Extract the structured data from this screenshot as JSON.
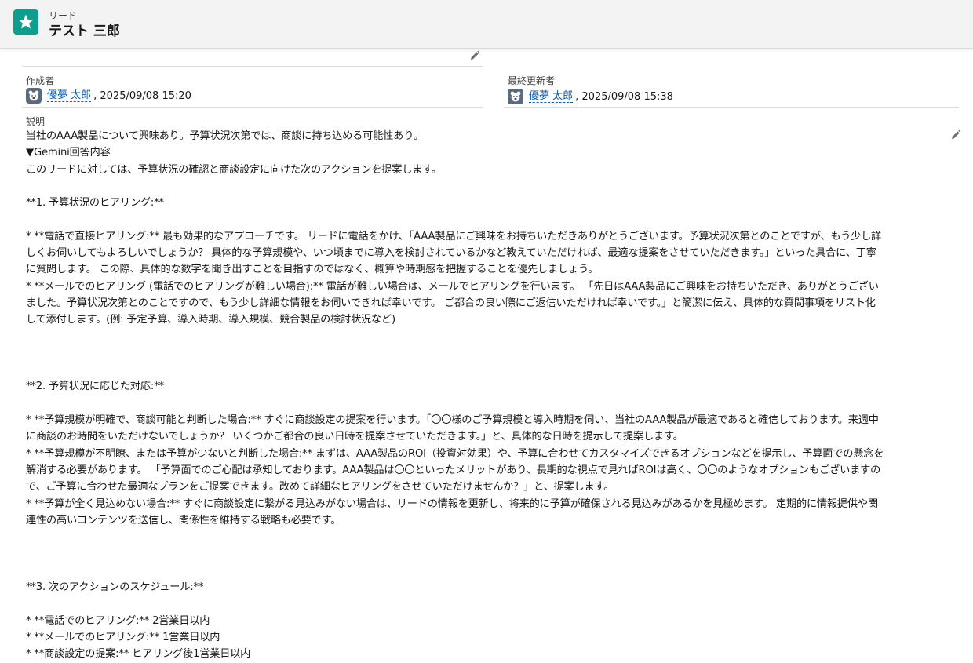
{
  "header": {
    "object_type": "リード",
    "record_name": "テスト 三郎",
    "icon": "lead-star-icon",
    "icon_color": "#0d9e8e"
  },
  "created_by": {
    "label": "作成者",
    "user": "優夢 太郎",
    "date": ", 2025/09/08 15:20"
  },
  "last_modified_by": {
    "label": "最終更新者",
    "user": "優夢 太郎",
    "date": ", 2025/09/08 15:38"
  },
  "description": {
    "label": "説明",
    "lines": [
      "当社のAAA製品について興味あり。予算状況次第では、商談に持ち込める可能性あり。",
      "▼Gemini回答内容",
      "このリードに対しては、予算状況の確認と商談設定に向けた次のアクションを提案します。",
      "",
      "**1. 予算状況のヒアリング:**",
      "",
      "* **電話で直接ヒアリング:** 最も効果的なアプローチです。 リードに電話をかけ、「AAA製品にご興味をお持ちいただきありがとうございます。予算状況次第とのことですが、もう少し詳",
      "しくお伺いしてもよろしいでしょうか？ 具体的な予算規模や、いつ頃までに導入を検討されているかなど教えていただければ、最適な提案をさせていただきます。」といった具合に、丁寧",
      "に質問します。 この際、具体的な数字を聞き出すことを目指すのではなく、概算や時期感を把握することを優先しましょう。",
      "* **メールでのヒアリング (電話でのヒアリングが難しい場合):** 電話が難しい場合は、メールでヒアリングを行います。 「先日はAAA製品にご興味をお持ちいただき、ありがとうござい",
      "ました。予算状況次第とのことですので、もう少し詳細な情報をお伺いできれば幸いです。 ご都合の良い際にご返信いただければ幸いです。」と簡潔に伝え、具体的な質問事項をリスト化",
      "して添付します。(例: 予定予算、導入時期、導入規模、競合製品の検討状況など)",
      "",
      "",
      "",
      "**2. 予算状況に応じた対応:**",
      "",
      "* **予算規模が明確で、商談可能と判断した場合:** すぐに商談設定の提案を行います。「〇〇様のご予算規模と導入時期を伺い、当社のAAA製品が最適であると確信しております。来週中",
      "に商談のお時間をいただけないでしょうか？ いくつかご都合の良い日時を提案させていただきます。」と、具体的な日時を提示して提案します。",
      "* **予算規模が不明瞭、または予算が少ないと判断した場合:** まずは、AAA製品のROI（投資対効果）や、予算に合わせてカスタマイズできるオプションなどを提示し、予算面での懸念を",
      "解消する必要があります。 「予算面でのご心配は承知しております。AAA製品は〇〇といったメリットがあり、長期的な視点で見ればROIは高く、〇〇のようなオプションもございますの",
      "で、ご予算に合わせた最適なプランをご提案できます。改めて詳細なヒアリングをさせていただけませんか？」と、提案します。",
      "* **予算が全く見込めない場合:** すぐに商談設定に繋がる見込みがない場合は、リードの情報を更新し、将来的に予算が確保される見込みがあるかを見極めます。 定期的に情報提供や関",
      "連性の高いコンテンツを送信し、関係性を維持する戦略も必要です。",
      "",
      "",
      "",
      "**3. 次のアクションのスケジュール:**",
      "",
      "* **電話でのヒアリング:** 2営業日以内",
      "* **メールでのヒアリング:** 1営業日以内",
      "* **商談設定の提案:** ヒアリング後1営業日以内"
    ]
  },
  "icons": {
    "edit": "pencil-icon",
    "avatar": "bear-avatar-icon"
  },
  "colors": {
    "link": "#0b5cab",
    "header_bg": "#f3f3f3"
  }
}
